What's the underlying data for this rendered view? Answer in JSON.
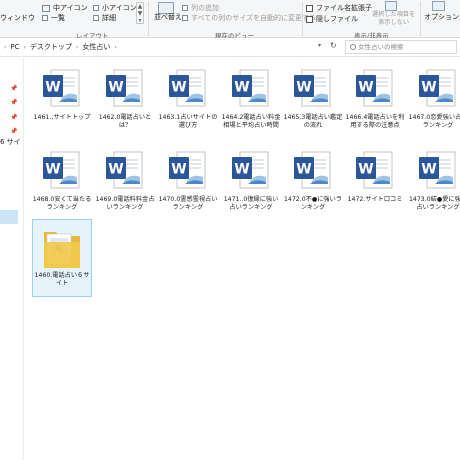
{
  "ribbon": {
    "window_label": "ウィンドウ",
    "medium_icons": "中アイコン",
    "list": "一覧",
    "small_icons": "小アイコン",
    "details": "詳細",
    "layout_label": "レイアウト",
    "sort_by": "並べ替え",
    "add_column": "列の追加",
    "size_all_columns": "すべての列のサイズを自動的に変更する",
    "current_view_label": "現在のビュー",
    "file_extensions": "ファイル名拡張子",
    "hidden_files": "隠しファイル",
    "hide_selected": "選択した項目を\n表示しない",
    "show_hide_label": "表示/非表示",
    "options": "オプション"
  },
  "address": {
    "crumbs": [
      "PC",
      "デスクトップ",
      "女性占い"
    ],
    "search_placeholder": "女性占いの検索"
  },
  "nav": {
    "partial_label": "6 サイ"
  },
  "files": [
    {
      "name": "1461.,サイトトップ"
    },
    {
      "name": "1462.0電話占いとは？"
    },
    {
      "name": "1463.1占いサイトの選び方"
    },
    {
      "name": "1464.2電話占い料金相場と平均占い時間"
    },
    {
      "name": "1465.3電話占い鑑定の流れ"
    },
    {
      "name": "1466.4電話占いを利用する際の注意点"
    },
    {
      "name": "1467.0恋愛強い占いランキング"
    },
    {
      "name": "1468.0安くて当たるランキング"
    },
    {
      "name": "1469.0電話料料金占いランキング"
    },
    {
      "name": "1470.0霊感霊視占いランキング"
    },
    {
      "name": "1471..0復縁に強い占いランキング"
    },
    {
      "name": "1472.0不●に強いランキング"
    },
    {
      "name": "1472.サイト口コミ"
    },
    {
      "name": "1473.0結●愛に強い占いランキング"
    }
  ],
  "folder": {
    "name": "1460.電話占い６サイト"
  },
  "colors": {
    "selection_bg": "#e5f3fb",
    "selection_border": "#99d1f3",
    "word_blue": "#2b579a",
    "folder_yellow": "#f2c94c"
  }
}
